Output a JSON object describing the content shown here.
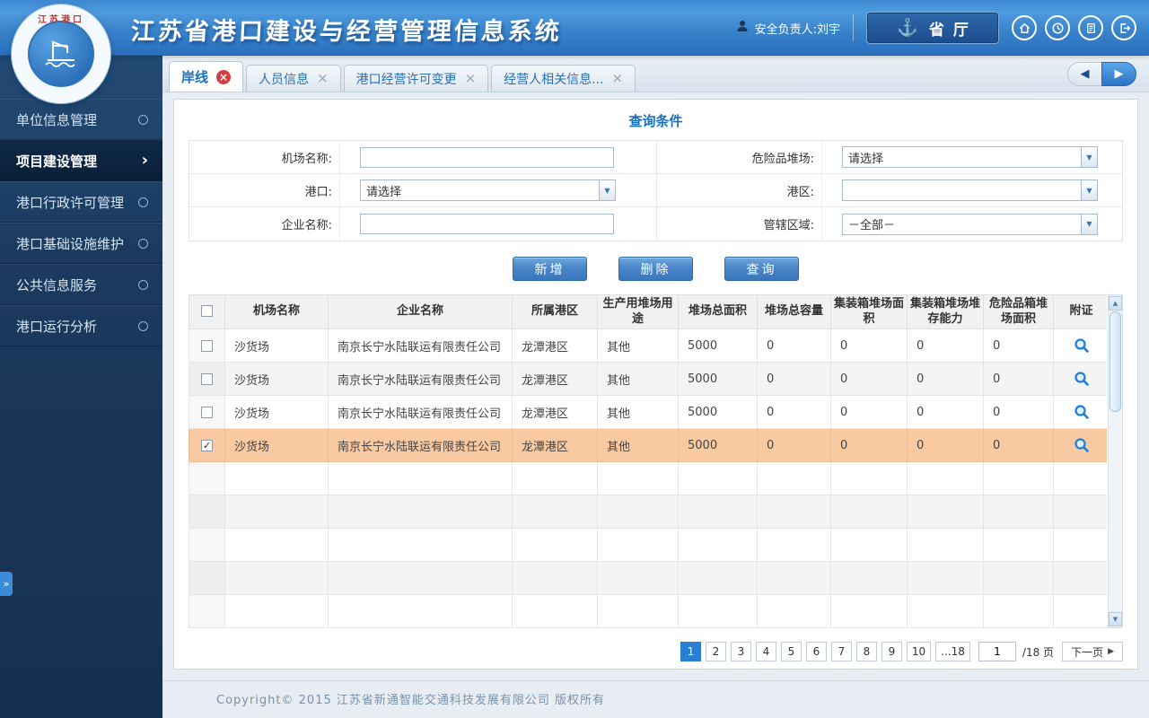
{
  "colors": {
    "header_blue": "#3a84cc",
    "sidebar_bg": "#1b3a5e",
    "accent_blue": "#2a7fd4",
    "selected_row": "#f9c9a2",
    "active_tab_text": "#1a6fbf",
    "close_badge_red": "#d3403e",
    "button_blue": "#3a76ba"
  },
  "icons": {
    "dropdown": "▼",
    "prev_tab": "◀",
    "next_tab": "▶",
    "scroll_up": "▲",
    "scroll_down": "▼",
    "collapse_expand": "»",
    "anchor": "⚓",
    "check": "✓",
    "chevron_right": "›",
    "close_active": "×",
    "close_inactive": "×",
    "next_page_arrow": "▶"
  },
  "header": {
    "title": "江苏省港口建设与经营管理信息系统",
    "logo_text": "江苏港口",
    "user": "安全负责人:刘宇",
    "org_button": "省厅"
  },
  "sidebar": {
    "items": [
      {
        "label": "单位信息管理",
        "active": false
      },
      {
        "label": "项目建设管理",
        "active": true
      },
      {
        "label": "港口行政许可管理",
        "active": false
      },
      {
        "label": "港口基础设施维护",
        "active": false
      },
      {
        "label": "公共信息服务",
        "active": false
      },
      {
        "label": "港口运行分析",
        "active": false
      }
    ]
  },
  "tabs": {
    "items": [
      {
        "label": "岸线",
        "active": true
      },
      {
        "label": "人员信息",
        "active": false
      },
      {
        "label": "港口经营许可变更",
        "active": false
      },
      {
        "label": "经营人相关信息...",
        "active": false
      }
    ]
  },
  "query": {
    "title": "查询条件",
    "rows": [
      [
        {
          "label": "机场名称:",
          "type": "input",
          "value": ""
        },
        {
          "label": "危险品堆场:",
          "type": "select",
          "value": "请选择"
        }
      ],
      [
        {
          "label": "港口:",
          "type": "select",
          "value": "请选择"
        },
        {
          "label": "港区:",
          "type": "select",
          "value": ""
        }
      ],
      [
        {
          "label": "企业名称:",
          "type": "input",
          "value": ""
        },
        {
          "label": "管辖区域:",
          "type": "select",
          "value": "－全部－"
        }
      ]
    ]
  },
  "actions": {
    "add": "新增",
    "delete": "删除",
    "search": "查询"
  },
  "table": {
    "headers": [
      "机场名称",
      "企业名称",
      "所属港区",
      "生产用堆场用途",
      "堆场总面积",
      "堆场总容量",
      "集装箱堆场面积",
      "集装箱堆场堆存能力",
      "危险品箱堆场面积",
      "附证"
    ],
    "rows": [
      {
        "checked": false,
        "selected": false,
        "cells": [
          "沙货场",
          "南京长宁水陆联运有限责任公司",
          "龙潭港区",
          "其他",
          "5000",
          "0",
          "0",
          "0",
          "0"
        ]
      },
      {
        "checked": false,
        "selected": false,
        "cells": [
          "沙货场",
          "南京长宁水陆联运有限责任公司",
          "龙潭港区",
          "其他",
          "5000",
          "0",
          "0",
          "0",
          "0"
        ]
      },
      {
        "checked": false,
        "selected": false,
        "cells": [
          "沙货场",
          "南京长宁水陆联运有限责任公司",
          "龙潭港区",
          "其他",
          "5000",
          "0",
          "0",
          "0",
          "0"
        ]
      },
      {
        "checked": true,
        "selected": true,
        "cells": [
          "沙货场",
          "南京长宁水陆联运有限责任公司",
          "龙潭港区",
          "其他",
          "5000",
          "0",
          "0",
          "0",
          "0"
        ]
      }
    ],
    "empty_rows": 5
  },
  "pagination": {
    "pages": [
      "1",
      "2",
      "3",
      "4",
      "5",
      "6",
      "7",
      "8",
      "9",
      "10",
      "...18"
    ],
    "active_page": "1",
    "page_input": "1",
    "total_label": "/18 页",
    "next_label": "下一页"
  },
  "footer": {
    "copyright": "Copyright©  2015  江苏省新通智能交通科技发展有限公司  版权所有"
  }
}
